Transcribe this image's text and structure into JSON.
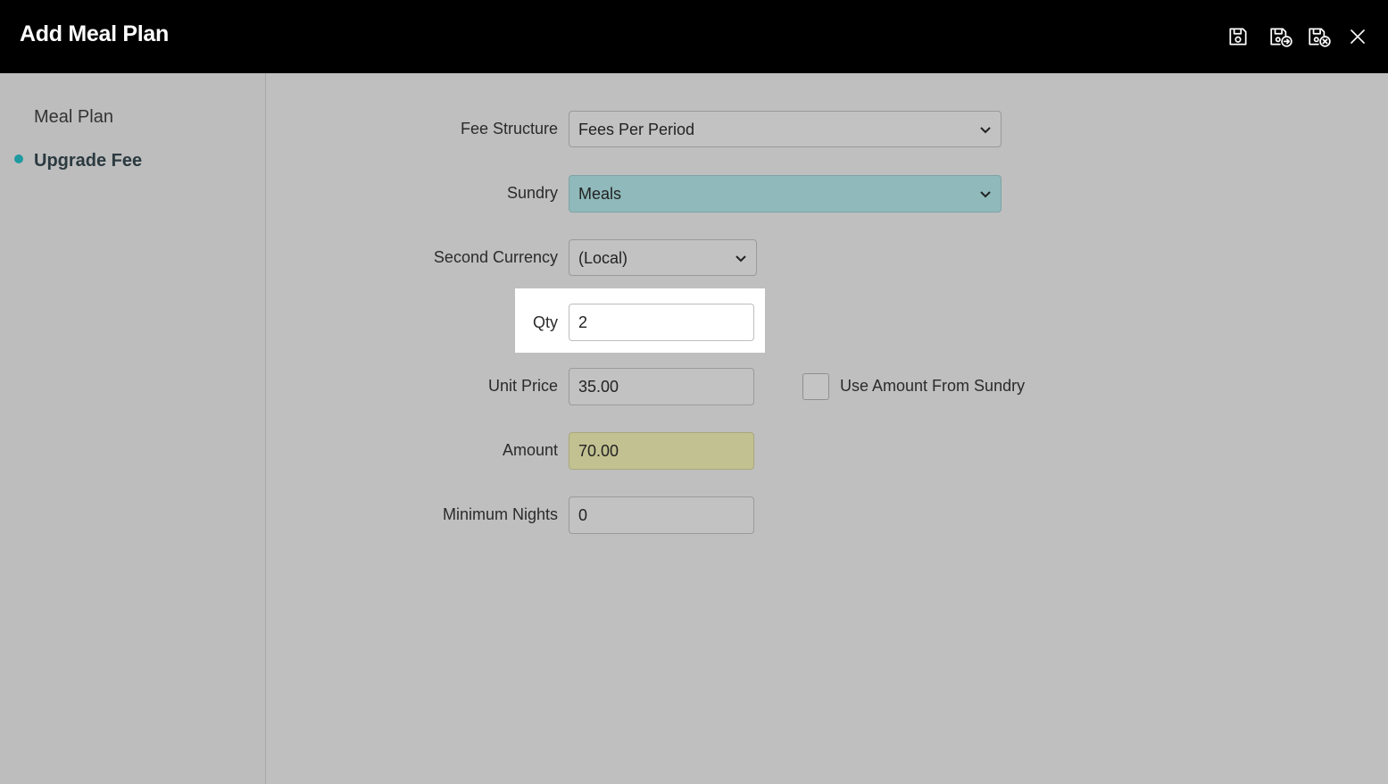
{
  "header": {
    "title": "Add Meal Plan",
    "icons": [
      "save-icon",
      "save-and-new-icon",
      "save-and-close-icon",
      "close-icon"
    ]
  },
  "sidebar": {
    "items": [
      {
        "label": "Meal Plan",
        "active": false
      },
      {
        "label": "Upgrade Fee",
        "active": true
      }
    ]
  },
  "form": {
    "fee_structure": {
      "label": "Fee Structure",
      "value": "Fees Per Period"
    },
    "sundry": {
      "label": "Sundry",
      "value": "Meals",
      "color": "#8fb9bb"
    },
    "second_currency": {
      "label": "Second Currency",
      "value": "(Local)"
    },
    "qty": {
      "label": "Qty",
      "value": "2"
    },
    "unit_price": {
      "label": "Unit Price",
      "value": "35.00"
    },
    "use_amount_from_sundry": {
      "label": "Use Amount From Sundry",
      "checked": false
    },
    "amount": {
      "label": "Amount",
      "value": "70.00",
      "color": "#c2c191"
    },
    "minimum_nights": {
      "label": "Minimum Nights",
      "value": "0"
    }
  }
}
